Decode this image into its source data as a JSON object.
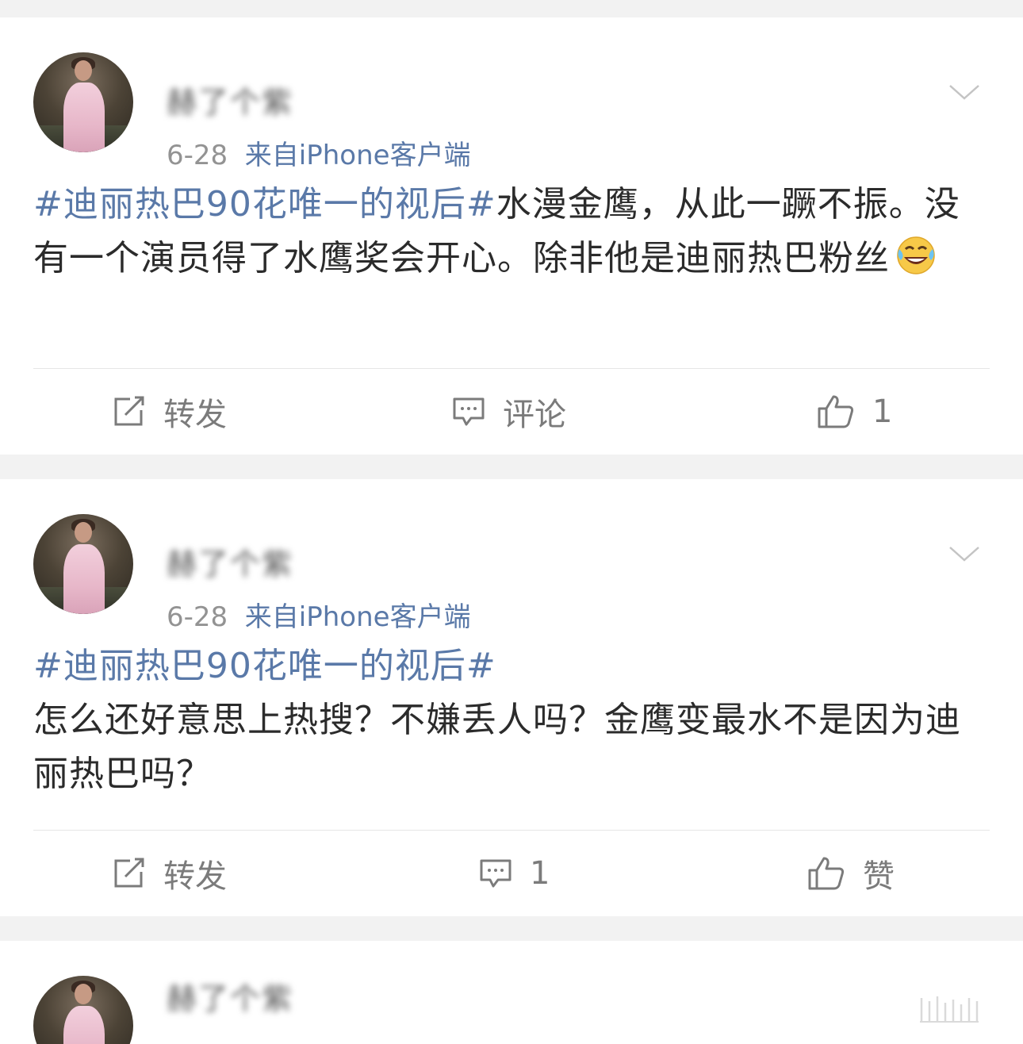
{
  "posts": [
    {
      "username": "赫了个紫",
      "date": "6-28",
      "source": "来自iPhone客户端",
      "topic": "#迪丽热巴90花唯一的视后#",
      "text": "水漫金鹰，从此一蹶不振。没有一个演员得了水鹰奖会开心。除非他是迪丽热巴粉丝",
      "emoji": "laugh-cry-emoji",
      "forward_label": "转发",
      "comment_label": "评论",
      "like_label": "1"
    },
    {
      "username": "赫了个紫",
      "date": "6-28",
      "source": "来自iPhone客户端",
      "topic": "#迪丽热巴90花唯一的视后#",
      "text": "怎么还好意思上热搜？不嫌丢人吗？金鹰变最水不是因为迪丽热巴吗？",
      "forward_label": "转发",
      "comment_label": "1",
      "like_label": "赞"
    },
    {
      "username": "赫了个紫"
    }
  ],
  "colors": {
    "link": "#5a79a8",
    "meta": "#939393",
    "text": "#2b2b2b",
    "action": "#7b7b7b",
    "background": "#f2f2f2"
  }
}
